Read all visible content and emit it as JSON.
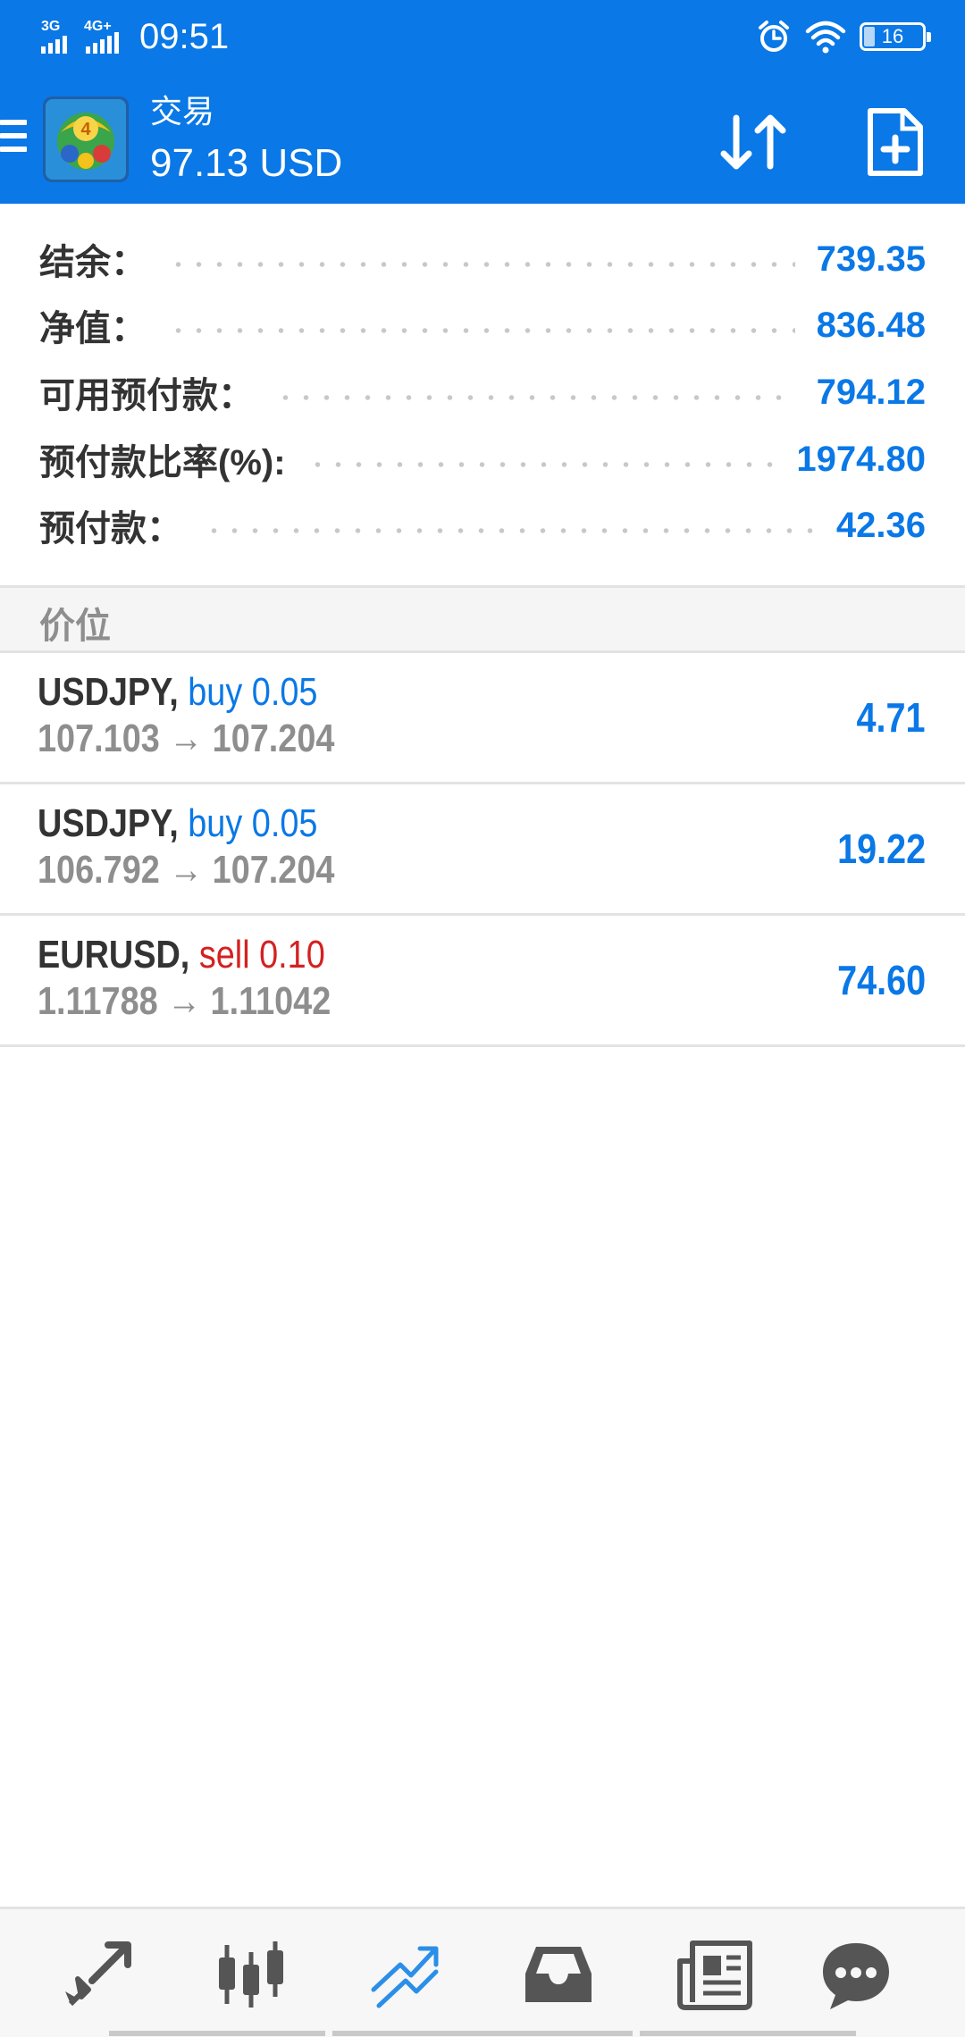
{
  "status_bar": {
    "network_left": "3G",
    "network_right": "4G+",
    "time": "09:51",
    "battery": "16"
  },
  "toolbar": {
    "title": "交易",
    "subtitle": "97.13 USD",
    "accent_color": "#0a78e6"
  },
  "summary": [
    {
      "label": "结余：",
      "value": "739.35"
    },
    {
      "label": "净值：",
      "value": "836.48"
    },
    {
      "label": "可用预付款：",
      "value": "794.12"
    },
    {
      "label": "预付款比率(%):",
      "value": "1974.80"
    },
    {
      "label": "预付款：",
      "value": "42.36"
    }
  ],
  "section": {
    "title": "价位"
  },
  "positions": [
    {
      "symbol": "USDJPY,",
      "side": "buy 0.05",
      "prices": "107.103 → 107.204",
      "profit": "4.71"
    },
    {
      "symbol": "USDJPY,",
      "side": "buy 0.05",
      "prices": "106.792 → 107.204",
      "profit": "19.22"
    },
    {
      "symbol": "EURUSD,",
      "side": "sell 0.10",
      "prices": "1.11788 → 1.11042",
      "profit": "74.60"
    }
  ],
  "bottom_nav": [
    {
      "icon": "quotes-icon",
      "active": false
    },
    {
      "icon": "chart-candles-icon",
      "active": false
    },
    {
      "icon": "trade-icon",
      "active": true
    },
    {
      "icon": "history-inbox-icon",
      "active": false
    },
    {
      "icon": "news-icon",
      "active": false
    },
    {
      "icon": "chat-icon",
      "active": false
    }
  ],
  "colors": {
    "positive": "#0a78e6",
    "sell": "#d42121",
    "muted": "#8e8e8e",
    "text": "#333333"
  }
}
